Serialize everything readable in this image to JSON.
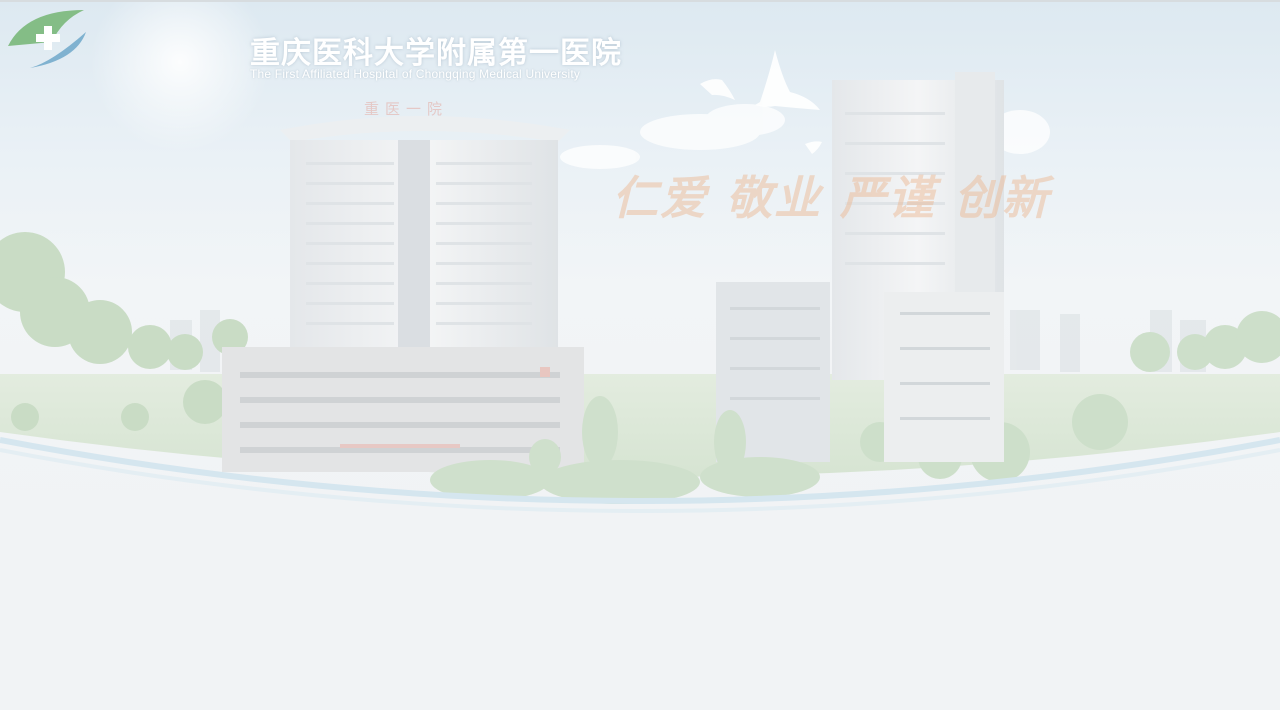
{
  "header": {
    "hospital_name_cn": "重庆医科大学附属第一医院",
    "hospital_name_en": "The First Affiliated Hospital of Chongqing Medical University",
    "logo_icon": "green-cross-logo-icon"
  },
  "banner": {
    "building_sign": "重医一院",
    "slogan": "仁爱 敬业 严谨 创新"
  }
}
